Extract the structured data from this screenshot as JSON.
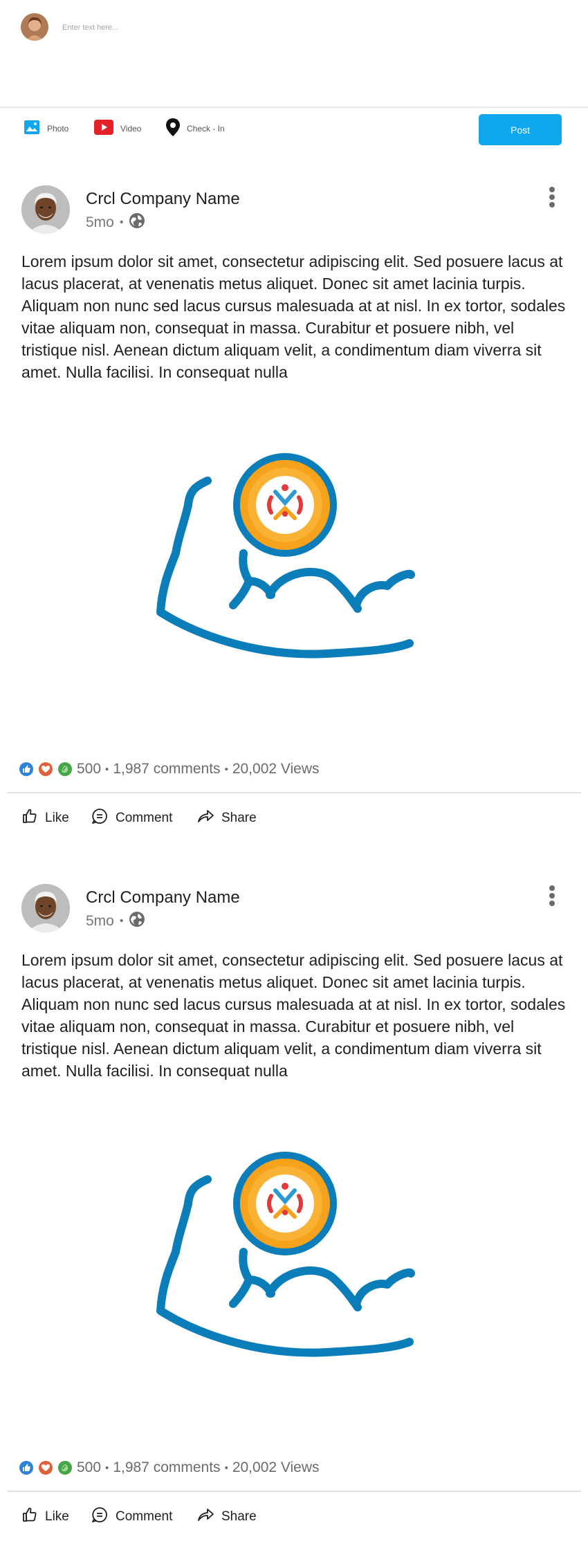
{
  "composer": {
    "placeholder": "Enter text here...",
    "actions": [
      {
        "label": "Photo",
        "icon": "image-icon",
        "color": "#0fa8ee"
      },
      {
        "label": "Video",
        "icon": "play-icon",
        "color": "#e32128"
      },
      {
        "label": "Check - In",
        "icon": "map-pin-icon",
        "color": "#111111"
      }
    ],
    "post_label": "Post"
  },
  "colors": {
    "accent": "#0fa8ee",
    "arm_stroke": "#0b7db8",
    "medal_outer": "#f6a21c",
    "medal_inner": "#f9b233"
  },
  "posts": [
    {
      "company": "Crcl Company Name",
      "time": "5mo",
      "separator": "•",
      "visibility_icon": "globe-icon",
      "body": "Lorem ipsum dolor sit amet, consectetur adipiscing elit. Sed posuere lacus at lacus placerat, at venenatis metus aliquet. Donec sit amet lacinia turpis. Aliquam non nunc sed lacus cursus malesuada at at nisl. In ex tortor, sodales vitae aliquam non, consequat in massa. Curabitur et posuere nibh, vel tristique nisl. Aenean dictum aliquam velit, a condimentum diam viverra sit amet. Nulla facilisi. In consequat nulla",
      "stats": {
        "reactions": "500",
        "comments": "1,987 comments",
        "views": "20,002 Views",
        "separator": "•"
      },
      "actions": {
        "like": "Like",
        "comment": "Comment",
        "share": "Share"
      }
    },
    {
      "company": "Crcl Company Name",
      "time": "5mo",
      "separator": "•",
      "visibility_icon": "globe-icon",
      "body": "Lorem ipsum dolor sit amet, consectetur adipiscing elit. Sed posuere lacus at lacus placerat, at venenatis metus aliquet. Donec sit amet lacinia turpis. Aliquam non nunc sed lacus cursus malesuada at at nisl. In ex tortor, sodales vitae aliquam non, consequat in massa. Curabitur et posuere nibh, vel tristique nisl. Aenean dictum aliquam velit, a condimentum diam viverra sit amet. Nulla facilisi. In consequat nulla",
      "stats": {
        "reactions": "500",
        "comments": "1,987 comments",
        "views": "20,002 Views",
        "separator": "•"
      },
      "actions": {
        "like": "Like",
        "comment": "Comment",
        "share": "Share"
      }
    }
  ]
}
